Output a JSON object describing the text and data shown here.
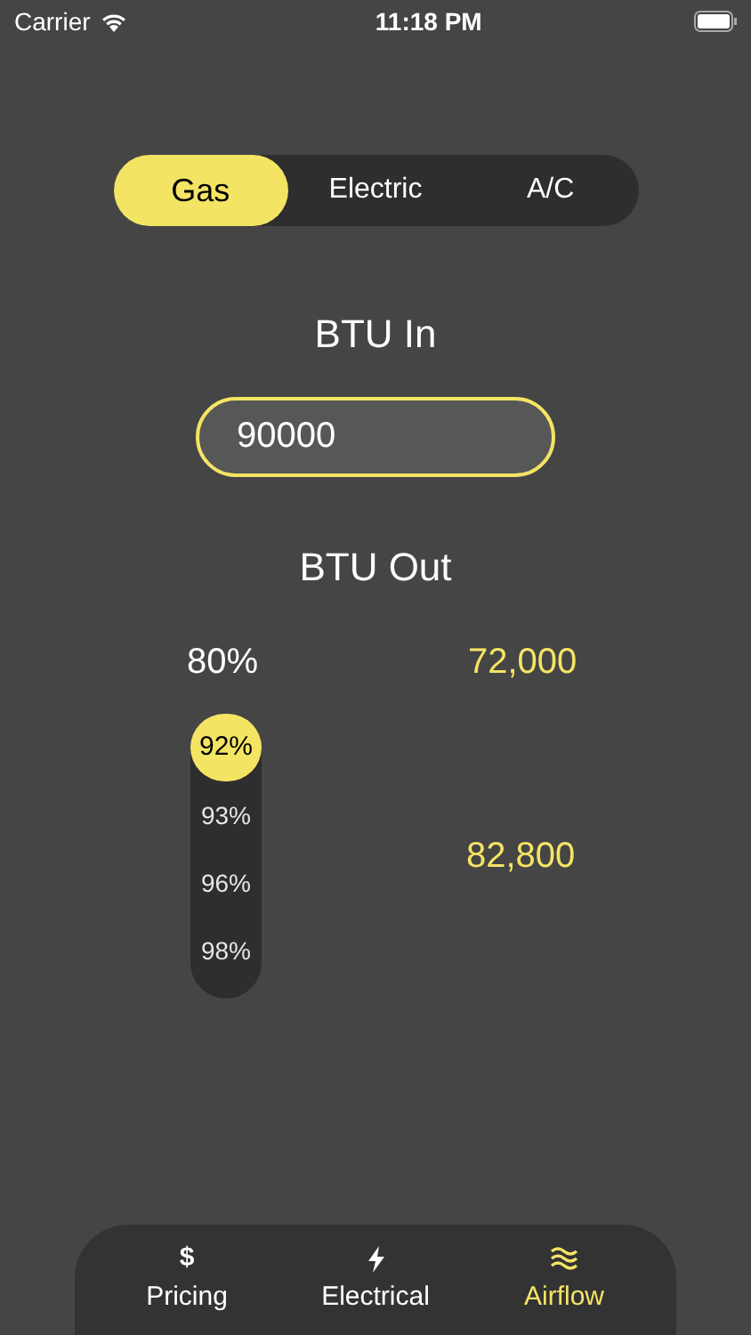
{
  "status_bar": {
    "carrier": "Carrier",
    "time": "11:18 PM"
  },
  "segments": [
    {
      "label": "Gas",
      "selected": true
    },
    {
      "label": "Electric",
      "selected": false
    },
    {
      "label": "A/C",
      "selected": false
    }
  ],
  "input": {
    "label": "BTU In",
    "value": "90000"
  },
  "output": {
    "label": "BTU Out",
    "fixed": {
      "efficiency": "80%",
      "result": "72,000"
    },
    "picker": {
      "options": [
        {
          "label": "92%",
          "selected": true
        },
        {
          "label": "93%",
          "selected": false
        },
        {
          "label": "96%",
          "selected": false
        },
        {
          "label": "98%",
          "selected": false
        }
      ],
      "result": "82,800"
    }
  },
  "tab_bar": [
    {
      "label": "Pricing",
      "kind": "dollar",
      "symbol": "$",
      "selected": false
    },
    {
      "label": "Electrical",
      "kind": "bolt",
      "selected": false
    },
    {
      "label": "Airflow",
      "kind": "waves",
      "selected": true
    }
  ]
}
